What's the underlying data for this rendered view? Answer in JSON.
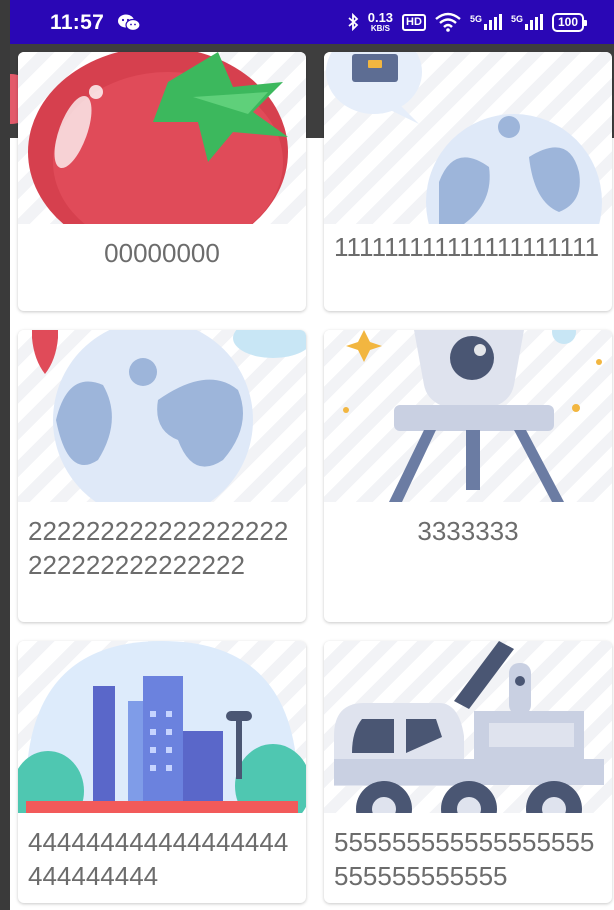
{
  "status_bar": {
    "time": "11:57",
    "network_speed": "0.13",
    "network_unit": "KB/S",
    "hd_label": "HD",
    "signal_label_1": "5G",
    "signal_label_2": "5G",
    "battery": "100",
    "background_color": "#2a07b5"
  },
  "cards": [
    {
      "caption": "00000000",
      "image": "tomato-illustration"
    },
    {
      "caption": "111111111111111111111",
      "image": "chat-globe-illustration"
    },
    {
      "caption": "222222222222222222222222222222222",
      "image": "globe-pin-illustration"
    },
    {
      "caption": "3333333",
      "image": "space-probe-illustration"
    },
    {
      "caption": "444444444444444444444444444",
      "image": "city-dome-illustration"
    },
    {
      "caption": "555555555555555555555555555555",
      "image": "rover-truck-illustration"
    }
  ]
}
